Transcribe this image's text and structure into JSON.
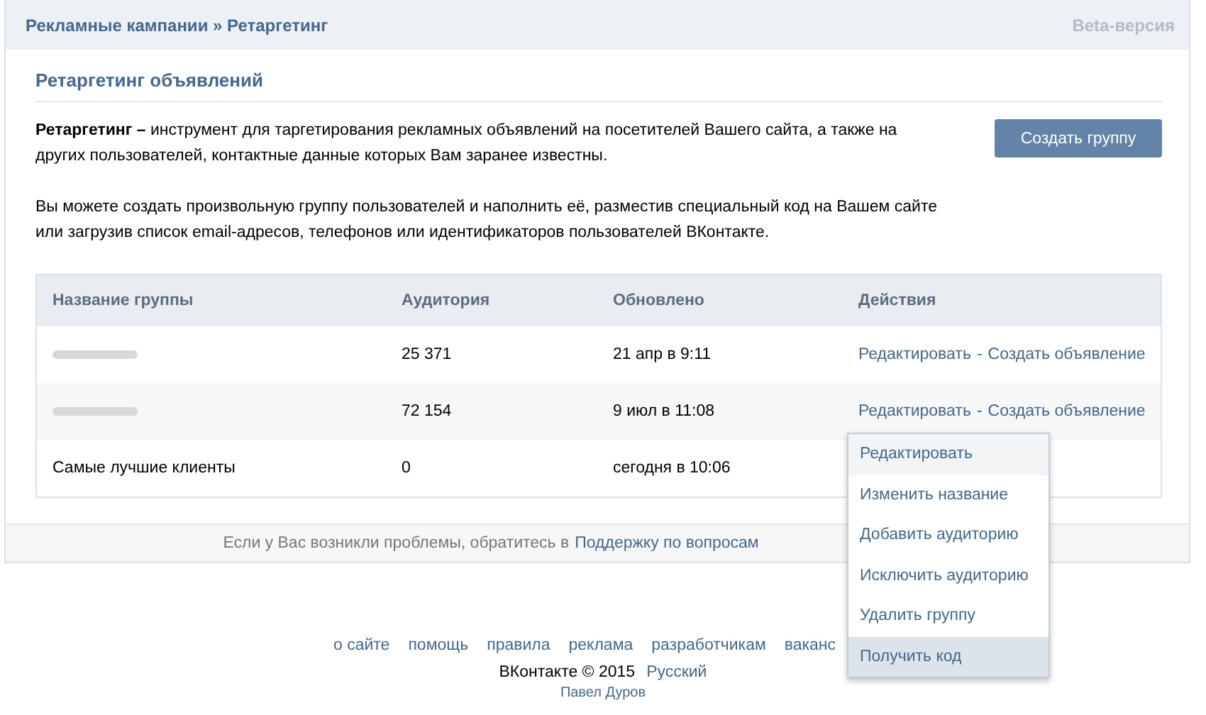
{
  "header": {
    "breadcrumb": "Рекламные кампании » Ретаргетинг",
    "beta": "Beta-версия"
  },
  "section_title": "Ретаргетинг объявлений",
  "intro": "**Ретаргетинг –** инструмент для таргетирования рекламных объявлений на посетителей Вашего сайта, а также на других пользователей, контактные данные которых Вам заранее известны.",
  "intro_2": "Вы можете создать произвольную группу пользователей и наполнить её, разместив специальный код на Вашем сайте или загрузив список email-адресов, телефонов или идентификаторов пользователей ВКонтакте.",
  "create_button": "Создать группу",
  "table": {
    "columns": [
      "Название группы",
      "Аудитория",
      "Обновлено",
      "Действия"
    ],
    "rows": [
      {
        "name_hidden": true,
        "audience": "25 371",
        "updated": "21 апр в 9:11",
        "actions": [
          "Редактировать",
          "Создать объявление"
        ],
        "separator": "-"
      },
      {
        "name_hidden": true,
        "audience": "72 154",
        "updated": "9 июл в 11:08",
        "actions": [
          "Редактировать",
          "Создать объявление"
        ],
        "separator": "-"
      },
      {
        "name": "Самые лучшие клиенты",
        "audience": "0",
        "updated": "сегодня в 10:06"
      }
    ]
  },
  "help_bar": {
    "text": "Если у Вас возникли проблемы, обратитесь в ",
    "link": "Поддержку по вопросам"
  },
  "footer": {
    "links": [
      "о сайте",
      "помощь",
      "правила",
      "реклама",
      "разработчикам",
      "ваканс"
    ],
    "copyright": "ВКонтакте © 2015",
    "language": "Русский",
    "author": "Павел Дуров"
  },
  "menu": [
    {
      "label": "Редактировать",
      "kind": "current",
      "selected": false
    },
    {
      "label": "Изменить название",
      "kind": "action",
      "selected": false
    },
    {
      "label": "Добавить аудиторию",
      "kind": "action",
      "selected": false
    },
    {
      "label": "Исключить аудиторию",
      "kind": "action",
      "selected": false
    },
    {
      "label": "Удалить группу",
      "kind": "action",
      "selected": false
    },
    {
      "label": "Получить код",
      "kind": "action",
      "selected": true
    }
  ]
}
